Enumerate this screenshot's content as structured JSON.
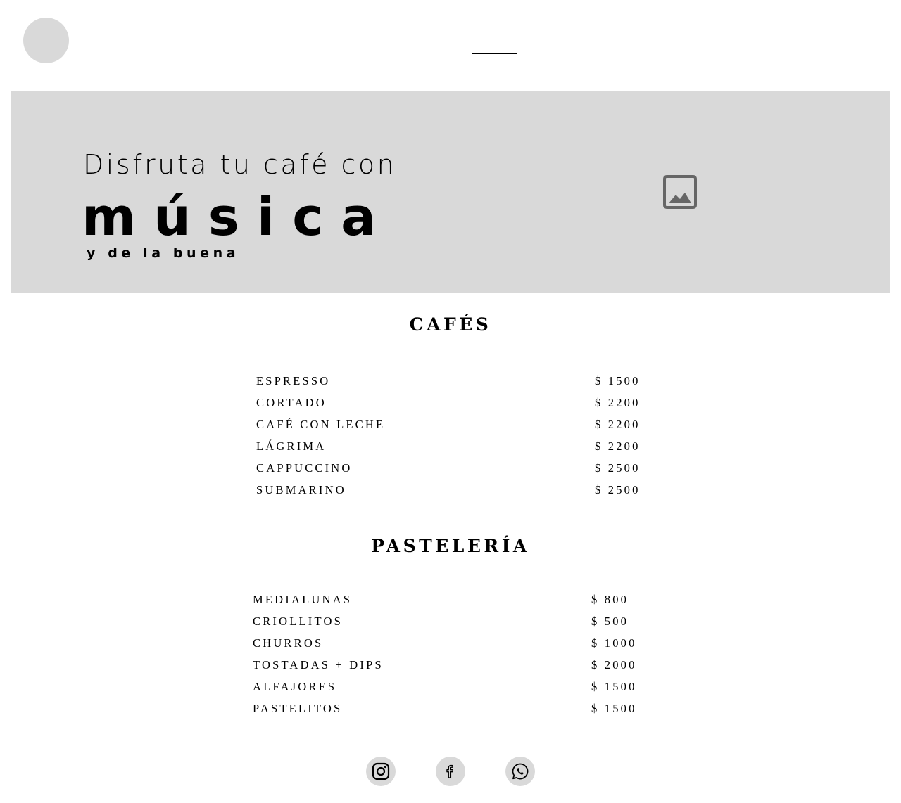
{
  "hero": {
    "line1": "Disfruta tu café con",
    "line2": "música",
    "line3": "y de la buena",
    "image_icon": "image-placeholder-icon"
  },
  "cafes": {
    "title": "CAFÉS",
    "items": [
      {
        "name": "ESPRESSO",
        "price": "$ 1500"
      },
      {
        "name": "CORTADO",
        "price": "$ 2200"
      },
      {
        "name": "CAFÉ CON LECHE",
        "price": "$ 2200"
      },
      {
        "name": "LÁGRIMA",
        "price": "$ 2200"
      },
      {
        "name": "CAPPUCCINO",
        "price": "$ 2500"
      },
      {
        "name": "SUBMARINO",
        "price": "$ 2500"
      }
    ]
  },
  "pasteleria": {
    "title": "PASTELERÍA",
    "items": [
      {
        "name": "MEDIALUNAS",
        "price": "$ 800"
      },
      {
        "name": "CRIOLLITOS",
        "price": "$ 500"
      },
      {
        "name": "CHURROS",
        "price": "$ 1000"
      },
      {
        "name": "TOSTADAS + DIPS",
        "price": "$ 2000"
      },
      {
        "name": "ALFAJORES",
        "price": "$ 1500"
      },
      {
        "name": "PASTELITOS",
        "price": "$ 1500"
      }
    ]
  },
  "social": [
    "instagram-icon",
    "facebook-icon",
    "whatsapp-icon"
  ],
  "colors": {
    "placeholder_gray": "#d9d9d9",
    "icon_gray": "#666666",
    "text": "#000000"
  }
}
